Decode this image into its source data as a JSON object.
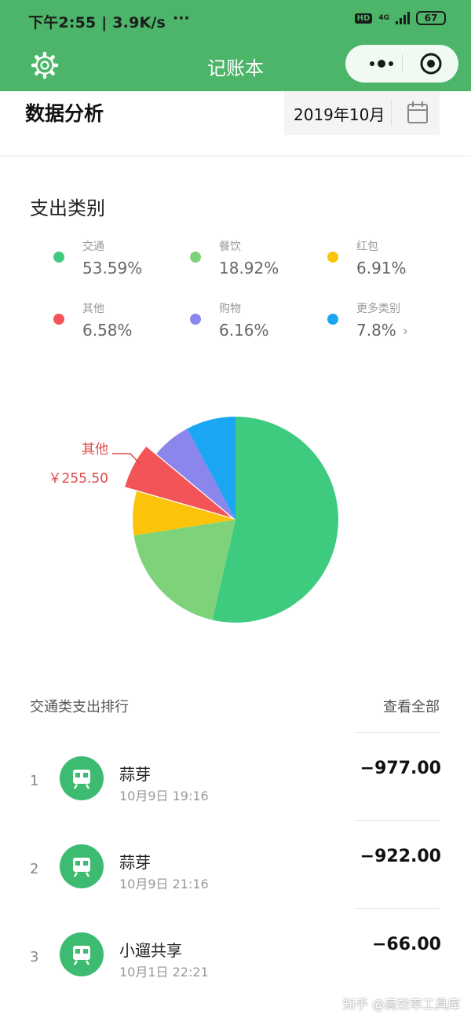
{
  "status_bar": {
    "time": "下午2:55 | 3.9K/s",
    "dots": "···",
    "hd": "HD",
    "network": "4G",
    "battery": "67"
  },
  "nav": {
    "title": "记账本"
  },
  "header": {
    "title": "数据分析",
    "date": "2019年10月"
  },
  "category": {
    "title": "支出类别",
    "legend": [
      {
        "name": "交通",
        "pct": "53.59%",
        "color": "#3ecb80"
      },
      {
        "name": "餐饮",
        "pct": "18.92%",
        "color": "#7ed37a"
      },
      {
        "name": "红包",
        "pct": "6.91%",
        "color": "#fbc40a"
      },
      {
        "name": "其他",
        "pct": "6.58%",
        "color": "#f25457"
      },
      {
        "name": "购物",
        "pct": "6.16%",
        "color": "#8b86ec"
      },
      {
        "name": "更多类别",
        "pct": "7.8%",
        "color": "#1aa6f3"
      }
    ],
    "more_arrow": "›"
  },
  "chart_data": {
    "type": "pie",
    "slices": [
      {
        "label": "交通",
        "value": 53.59,
        "color": "#3ecb80"
      },
      {
        "label": "餐饮",
        "value": 18.92,
        "color": "#7ed37a"
      },
      {
        "label": "红包",
        "value": 6.91,
        "color": "#fbc40a"
      },
      {
        "label": "其他",
        "value": 6.58,
        "color": "#f25457",
        "highlighted": true
      },
      {
        "label": "购物",
        "value": 6.16,
        "color": "#8b86ec"
      },
      {
        "label": "更多类别",
        "value": 7.8,
        "color": "#1aa6f3"
      }
    ],
    "callout": {
      "label": "其他",
      "value": "￥255.50",
      "color": "#e04b4b"
    }
  },
  "ranking": {
    "title": "交通类支出排行",
    "view_all": "查看全部",
    "rows": [
      {
        "index": "1",
        "name": "蒜芽",
        "time": "10月9日 19:16",
        "amount": "−977.00"
      },
      {
        "index": "2",
        "name": "蒜芽",
        "time": "10月9日 21:16",
        "amount": "−922.00"
      },
      {
        "index": "3",
        "name": "小遛共享",
        "time": "10月1日 22:21",
        "amount": "−66.00"
      }
    ]
  },
  "watermark": "知乎 @高效率工具库"
}
